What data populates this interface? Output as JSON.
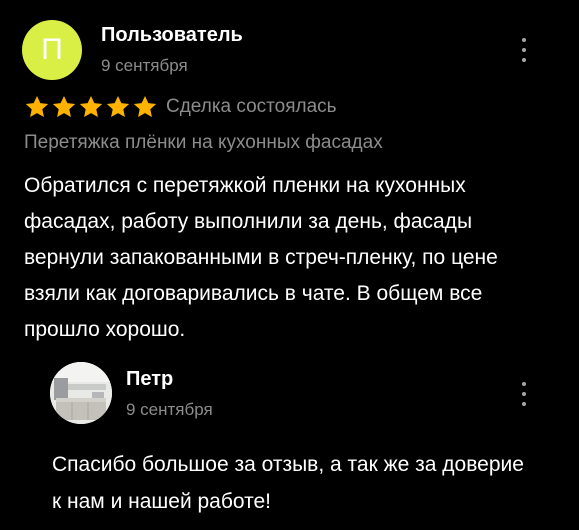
{
  "review": {
    "author_initial": "П",
    "author_name": "Пользователь",
    "date": "9 сентября",
    "rating": 5,
    "rating_max": 5,
    "deal_status": "Сделка состоялась",
    "service_title": "Перетяжка плёнки на кухонных фасадах",
    "text": "Обратился с перетяжкой пленки на кухонных фасадах, работу выполнили за день, фасады вернули запакованными в стреч-пленку, по цене взяли как договаривались в чате. В общем все прошло хорошо.",
    "avatar_color": "#d9ef45",
    "star_color": "#ffb300"
  },
  "reply": {
    "author_name": "Петр",
    "date": "9 сентября",
    "text": "Спасибо большое за отзыв, а так же за доверие к нам и нашей работе!"
  },
  "icons": {
    "menu": "more-vertical-icon",
    "star": "star-icon"
  }
}
